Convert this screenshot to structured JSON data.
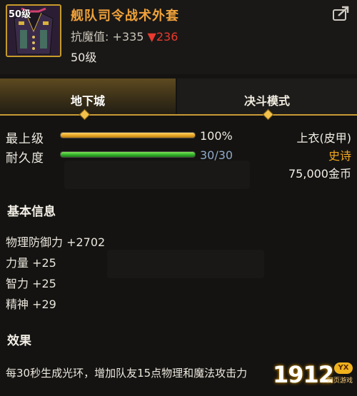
{
  "header": {
    "level_tag": "50级",
    "item_name": "舰队司令战术外套",
    "resist_label": "抗魔值:",
    "resist_value": "+335",
    "resist_down": "▼236",
    "item_level": "50级"
  },
  "tabs": [
    {
      "label": "地下城"
    },
    {
      "label": "决斗模式"
    }
  ],
  "stats": {
    "grade_label": "最上级",
    "grade_value": "100%",
    "grade_fraction": 1.0,
    "durability_label": "耐久度",
    "durability_value": "30/30",
    "durability_fraction": 1.0
  },
  "item_info": {
    "type": "上衣(皮甲)",
    "rarity": "史诗",
    "price": "75,000金币"
  },
  "basic_info": {
    "title": "基本信息",
    "attrs": [
      "物理防御力 +2702",
      "力量 +25",
      "智力 +25",
      "精神 +29"
    ]
  },
  "effect": {
    "title": "效果",
    "text": "每30秒生成光环，增加队友15点物理和魔法攻击力"
  },
  "watermark": {
    "number": "1912",
    "badge": "YX",
    "subtitle": "网页游戏"
  },
  "colors": {
    "name_orange": "#f0a23a",
    "rarity_epic": "#f2a81e",
    "resist_down_red": "#e83a2e",
    "tab_accent": "#c99a34"
  },
  "icons": [
    "coat-item-icon",
    "share-icon",
    "diamond-marker-icon"
  ]
}
